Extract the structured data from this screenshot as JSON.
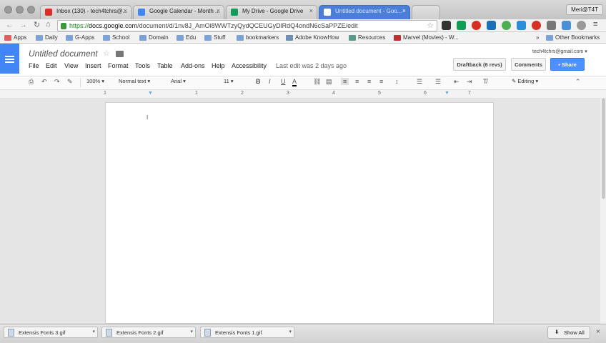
{
  "browser": {
    "tabs": [
      {
        "label": "Inbox (130) - tech4tchrs@...",
        "color": "#d93025"
      },
      {
        "label": "Google Calendar - Month ...",
        "color": "#4285f4"
      },
      {
        "label": "My Drive - Google Drive",
        "color": "#0f9d58"
      },
      {
        "label": "Untitled document - Goo...",
        "color": "#4285f4"
      }
    ],
    "close_glyph": "×",
    "profile": "Meri@T4T",
    "url_scheme": "https://",
    "url_host": "docs.google.com",
    "url_path": "/document/d/1nv8J_AmOi8WWTzyQydQCEUGyDlRdQ4ondN6cSaPPZE/edit"
  },
  "bookmarks": {
    "items": [
      "Apps",
      "Daily",
      "G-Apps",
      "School",
      "Domain",
      "Edu",
      "Stuff",
      "bookmarkers",
      "Adobe KnowHow",
      "Resources",
      "Marvel (Movies) - W..."
    ],
    "overflow": "»",
    "other": "Other Bookmarks"
  },
  "doc": {
    "title": "Untitled document",
    "account": "tech4tchrs@gmail.com ▾",
    "menus": [
      "File",
      "Edit",
      "View",
      "Insert",
      "Format",
      "Tools",
      "Table",
      "Add-ons",
      "Help",
      "Accessibility"
    ],
    "last_edit": "Last edit was 2 days ago",
    "draftback_label": "Draftback (6 revs)",
    "comments_label": "Comments",
    "share_label": "Share"
  },
  "format_bar": {
    "zoom": "100%",
    "style": "Normal text",
    "font": "Arial",
    "size": "11",
    "mode": "Editing"
  },
  "ruler": [
    "1",
    "1",
    "2",
    "3",
    "4",
    "5",
    "6",
    "7"
  ],
  "downloads": {
    "files": [
      "Extensis Fonts 3.gif",
      "Extensis Fonts 2.gif",
      "Extensis Fonts 1.gif"
    ],
    "show_all": "Show All"
  }
}
